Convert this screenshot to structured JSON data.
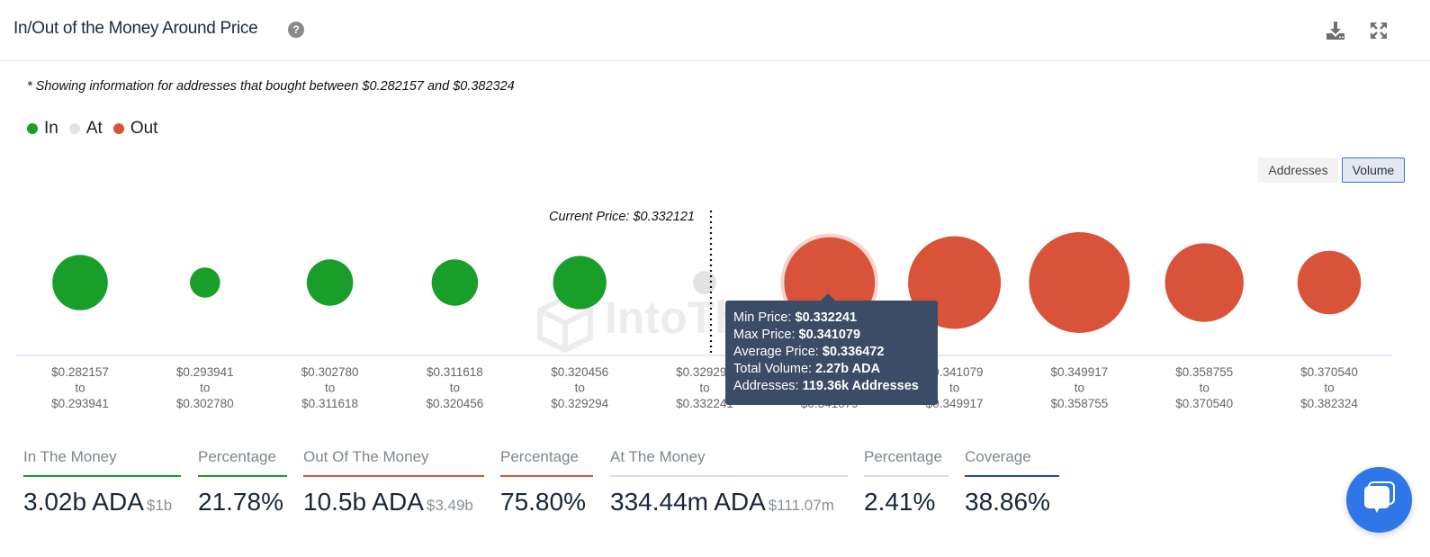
{
  "header": {
    "title": "In/Out of the Money Around Price",
    "help_icon": "question-circle-icon",
    "download_icon": "download-icon",
    "expand_icon": "expand-icon"
  },
  "note": "* Showing information for addresses that bought between $0.282157 and $0.382324",
  "legend": [
    {
      "label": "In",
      "color": "#1a9e2a"
    },
    {
      "label": "At",
      "color": "#e2e2e2"
    },
    {
      "label": "Out",
      "color": "#d9533a"
    }
  ],
  "toggles": {
    "addresses": "Addresses",
    "volume": "Volume",
    "active": "Volume"
  },
  "chart_data": {
    "type": "scatter",
    "title": "In/Out of the Money Around Price",
    "current_price_label": "Current Price: $0.332121",
    "current_price": 0.332121,
    "watermark": "IntoTheBlock",
    "colors": {
      "in": "#1a9e2a",
      "at": "#e2e2e2",
      "out": "#d9533a"
    },
    "bubbles": [
      {
        "min": "$0.282157",
        "max": "$0.293941",
        "status": "in",
        "relative_size": 0.55
      },
      {
        "min": "$0.293941",
        "max": "$0.302780",
        "status": "in",
        "relative_size": 0.3
      },
      {
        "min": "$0.302780",
        "max": "$0.311618",
        "status": "in",
        "relative_size": 0.46
      },
      {
        "min": "$0.311618",
        "max": "$0.320456",
        "status": "in",
        "relative_size": 0.46
      },
      {
        "min": "$0.320456",
        "max": "$0.329294",
        "status": "in",
        "relative_size": 0.53
      },
      {
        "min": "$0.329294",
        "max": "$0.332241",
        "status": "at",
        "relative_size": 0.23
      },
      {
        "min": "$0.332241",
        "max": "$0.341079",
        "status": "out",
        "relative_size": 0.9,
        "highlighted": true
      },
      {
        "min": "$0.341079",
        "max": "$0.349917",
        "status": "out",
        "relative_size": 0.92
      },
      {
        "min": "$0.349917",
        "max": "$0.358755",
        "status": "out",
        "relative_size": 1.0
      },
      {
        "min": "$0.358755",
        "max": "$0.370540",
        "status": "out",
        "relative_size": 0.78
      },
      {
        "min": "$0.370540",
        "max": "$0.382324",
        "status": "out",
        "relative_size": 0.63
      }
    ],
    "tick_connector": "to",
    "xlabel": "",
    "ylabel": "",
    "grid": false
  },
  "tooltip": {
    "rows": [
      {
        "label": "Min Price: ",
        "value": "$0.332241"
      },
      {
        "label": "Max Price: ",
        "value": "$0.341079"
      },
      {
        "label": "Average Price: ",
        "value": "$0.336472"
      },
      {
        "label": "Total Volume: ",
        "value": "2.27b ADA"
      },
      {
        "label": "Addresses: ",
        "value": "119.36k Addresses"
      }
    ]
  },
  "stats": [
    {
      "label": "In The Money",
      "value": "3.02b ADA",
      "sub": "$1b",
      "color": "#1a9e2a"
    },
    {
      "label": "Percentage",
      "value": "21.78%",
      "sub": "",
      "color": "#1a9e2a"
    },
    {
      "label": "Out Of The Money",
      "value": "10.5b ADA",
      "sub": "$3.49b",
      "color": "#d9533a"
    },
    {
      "label": "Percentage",
      "value": "75.80%",
      "sub": "",
      "color": "#d9533a"
    },
    {
      "label": "At The Money",
      "value": "334.44m ADA",
      "sub": "$111.07m",
      "color": "#dcdcdc"
    },
    {
      "label": "Percentage",
      "value": "2.41%",
      "sub": "",
      "color": "#dcdcdc"
    },
    {
      "label": "Coverage",
      "value": "38.86%",
      "sub": "",
      "color": "#1f46c9"
    }
  ],
  "chat_icon": "chat-bubbles-icon"
}
